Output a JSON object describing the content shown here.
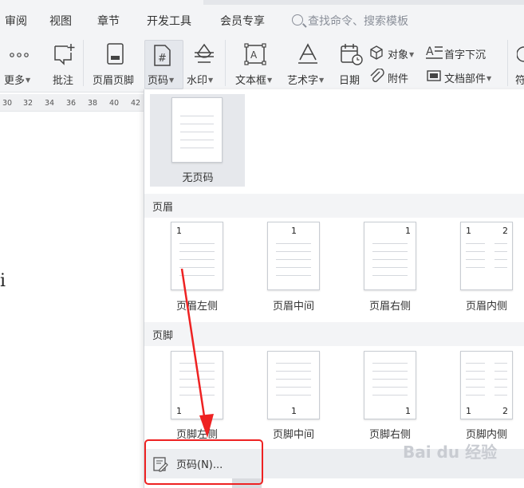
{
  "menu": {
    "tabs": [
      "审阅",
      "视图",
      "章节",
      "开发工具",
      "会员专享"
    ],
    "search_placeholder": "查找命令、搜索模板"
  },
  "ribbon": {
    "more": "更多",
    "comment": "批注",
    "header_footer": "页眉页脚",
    "page_number": "页码",
    "watermark": "水印",
    "textbox": "文本框",
    "wordart": "艺术字",
    "date": "日期",
    "object": "对象",
    "attachment": "附件",
    "dropcap": "首字下沉",
    "doc_parts": "文档部件",
    "symbol": "符"
  },
  "ruler": {
    "ticks": [
      "30",
      "32",
      "34",
      "36",
      "38",
      "40",
      "42"
    ]
  },
  "document": {
    "glyph": "i"
  },
  "panel": {
    "no_page_number": "无页码",
    "header_section": "页眉",
    "footer_section": "页脚",
    "header_items": [
      {
        "label": "页眉左侧",
        "num": "1"
      },
      {
        "label": "页眉中间",
        "num": "1"
      },
      {
        "label": "页眉右侧",
        "num": "1"
      },
      {
        "label": "页眉内侧",
        "num": "1",
        "num2": "2"
      }
    ],
    "footer_items": [
      {
        "label": "页脚左侧",
        "num": "1"
      },
      {
        "label": "页脚中间",
        "num": "1"
      },
      {
        "label": "页脚右侧",
        "num": "1"
      },
      {
        "label": "页脚内侧",
        "num": "1",
        "num2": "2"
      }
    ],
    "page_number_dialog": "页码(N)..."
  },
  "colors": {
    "annotation_red": "#ee2222"
  },
  "watermark_text": "Bai du 经验"
}
